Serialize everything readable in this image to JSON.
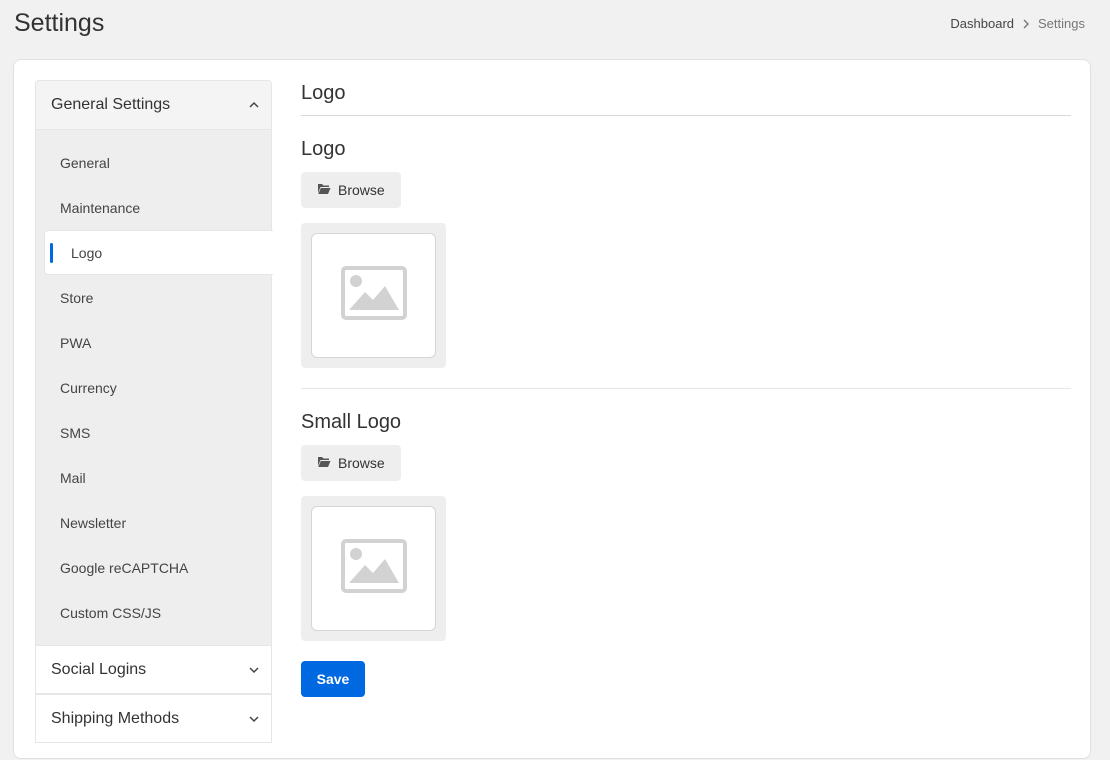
{
  "header": {
    "title": "Settings",
    "breadcrumb": {
      "home": "Dashboard",
      "current": "Settings"
    }
  },
  "sidebar": {
    "groups": [
      {
        "label": "General Settings",
        "expanded": true,
        "items": [
          {
            "label": "General"
          },
          {
            "label": "Maintenance"
          },
          {
            "label": "Logo",
            "active": true
          },
          {
            "label": "Store"
          },
          {
            "label": "PWA"
          },
          {
            "label": "Currency"
          },
          {
            "label": "SMS"
          },
          {
            "label": "Mail"
          },
          {
            "label": "Newsletter"
          },
          {
            "label": "Google reCAPTCHA"
          },
          {
            "label": "Custom CSS/JS"
          }
        ]
      },
      {
        "label": "Social Logins",
        "expanded": false
      },
      {
        "label": "Shipping Methods",
        "expanded": false
      }
    ]
  },
  "main": {
    "section_title": "Logo",
    "fields": [
      {
        "label": "Logo",
        "browse_label": "Browse"
      },
      {
        "label": "Small Logo",
        "browse_label": "Browse"
      }
    ],
    "save_label": "Save"
  },
  "colors": {
    "accent": "#0068e1",
    "panel": "#eeeeee",
    "page_bg": "#f1f1f1"
  },
  "icons": {
    "breadcrumb_separator": "chevron-right-icon",
    "accordion_open": "chevron-up-icon",
    "accordion_closed": "chevron-down-icon",
    "browse": "folder-open-icon",
    "image_placeholder": "image-placeholder-icon"
  }
}
